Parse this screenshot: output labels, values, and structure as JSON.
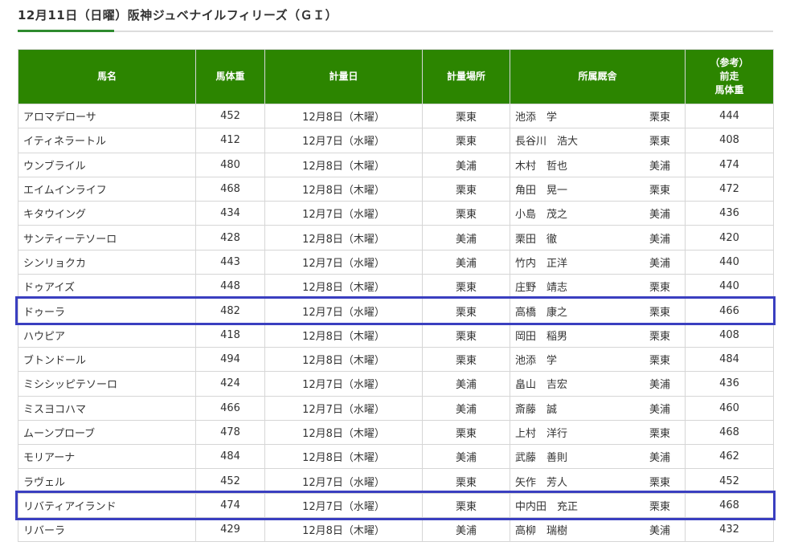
{
  "heading": "12月11日（日曜）阪神ジュベナイルフィリーズ（ＧＩ）",
  "table": {
    "headers": {
      "name": "馬名",
      "weight": "馬体重",
      "date": "計量日",
      "place": "計量場所",
      "trainer": "所属厩舎",
      "prev_line1": "（参考）",
      "prev_line2": "前走",
      "prev_line3": "馬体重"
    },
    "rows": [
      {
        "name": "アロマデローサ",
        "weight": "452",
        "date": "12月8日（木曜）",
        "place": "栗東",
        "trainer": "池添　学",
        "stable": "栗東",
        "prev": "444"
      },
      {
        "name": "イティネラートル",
        "weight": "412",
        "date": "12月7日（水曜）",
        "place": "栗東",
        "trainer": "長谷川　浩大",
        "stable": "栗東",
        "prev": "408"
      },
      {
        "name": "ウンブライル",
        "weight": "480",
        "date": "12月8日（木曜）",
        "place": "美浦",
        "trainer": "木村　哲也",
        "stable": "美浦",
        "prev": "474"
      },
      {
        "name": "エイムインライフ",
        "weight": "468",
        "date": "12月8日（木曜）",
        "place": "栗東",
        "trainer": "角田　晃一",
        "stable": "栗東",
        "prev": "472"
      },
      {
        "name": "キタウイング",
        "weight": "434",
        "date": "12月7日（水曜）",
        "place": "栗東",
        "trainer": "小島　茂之",
        "stable": "美浦",
        "prev": "436"
      },
      {
        "name": "サンティーテソーロ",
        "weight": "428",
        "date": "12月8日（木曜）",
        "place": "美浦",
        "trainer": "栗田　徹",
        "stable": "美浦",
        "prev": "420"
      },
      {
        "name": "シンリョクカ",
        "weight": "443",
        "date": "12月7日（水曜）",
        "place": "美浦",
        "trainer": "竹内　正洋",
        "stable": "美浦",
        "prev": "440"
      },
      {
        "name": "ドゥアイズ",
        "weight": "448",
        "date": "12月8日（木曜）",
        "place": "栗東",
        "trainer": "庄野　靖志",
        "stable": "栗東",
        "prev": "440"
      },
      {
        "name": "ドゥーラ",
        "weight": "482",
        "date": "12月7日（水曜）",
        "place": "栗東",
        "trainer": "高橋　康之",
        "stable": "栗東",
        "prev": "466"
      },
      {
        "name": "ハウピア",
        "weight": "418",
        "date": "12月8日（木曜）",
        "place": "栗東",
        "trainer": "岡田　稲男",
        "stable": "栗東",
        "prev": "408"
      },
      {
        "name": "ブトンドール",
        "weight": "494",
        "date": "12月8日（木曜）",
        "place": "栗東",
        "trainer": "池添　学",
        "stable": "栗東",
        "prev": "484"
      },
      {
        "name": "ミシシッピテソーロ",
        "weight": "424",
        "date": "12月7日（水曜）",
        "place": "美浦",
        "trainer": "畠山　吉宏",
        "stable": "美浦",
        "prev": "436"
      },
      {
        "name": "ミスヨコハマ",
        "weight": "466",
        "date": "12月7日（水曜）",
        "place": "美浦",
        "trainer": "斎藤　誠",
        "stable": "美浦",
        "prev": "460"
      },
      {
        "name": "ムーンプローブ",
        "weight": "478",
        "date": "12月8日（木曜）",
        "place": "栗東",
        "trainer": "上村　洋行",
        "stable": "栗東",
        "prev": "468"
      },
      {
        "name": "モリアーナ",
        "weight": "484",
        "date": "12月8日（木曜）",
        "place": "美浦",
        "trainer": "武藤　善則",
        "stable": "美浦",
        "prev": "462"
      },
      {
        "name": "ラヴェル",
        "weight": "452",
        "date": "12月7日（水曜）",
        "place": "栗東",
        "trainer": "矢作　芳人",
        "stable": "栗東",
        "prev": "452"
      },
      {
        "name": "リバティアイランド",
        "weight": "474",
        "date": "12月7日（水曜）",
        "place": "栗東",
        "trainer": "中内田　充正",
        "stable": "栗東",
        "prev": "468"
      },
      {
        "name": "リバーラ",
        "weight": "429",
        "date": "12月8日（木曜）",
        "place": "美浦",
        "trainer": "高柳　瑞樹",
        "stable": "美浦",
        "prev": "432"
      }
    ]
  },
  "colors": {
    "header_bg": "#2c8500",
    "highlight": "#3a3fc0",
    "accent": "#2e8b2e"
  }
}
